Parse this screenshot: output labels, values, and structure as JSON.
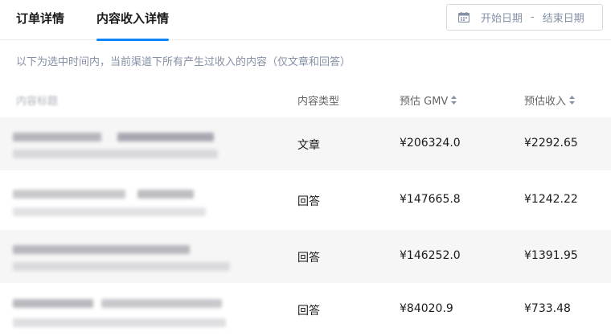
{
  "tabs": [
    {
      "label": "订单详情",
      "active": false
    },
    {
      "label": "内容收入详情",
      "active": true
    }
  ],
  "accent_color": "#0b84ff",
  "date_range": {
    "icon": "calendar-icon",
    "start_placeholder": "开始日期",
    "separator": "-",
    "end_placeholder": "结束日期"
  },
  "subtitle": "以下为选中时间内，当前渠道下所有产生过收入的内容（仅文章和回答）",
  "table": {
    "columns": [
      {
        "label": "内容标题",
        "sortable": false
      },
      {
        "label": "内容类型",
        "sortable": false
      },
      {
        "label": "预估 GMV",
        "sortable": true
      },
      {
        "label": "预估收入",
        "sortable": true
      }
    ],
    "rows": [
      {
        "title": "",
        "type": "文章",
        "gmv": "¥206324.0",
        "income": "¥2292.65"
      },
      {
        "title": "",
        "type": "回答",
        "gmv": "¥147665.8",
        "income": "¥1242.22"
      },
      {
        "title": "",
        "type": "回答",
        "gmv": "¥146252.0",
        "income": "¥1391.95"
      },
      {
        "title": "",
        "type": "回答",
        "gmv": "¥84020.9",
        "income": "¥733.48"
      }
    ]
  }
}
